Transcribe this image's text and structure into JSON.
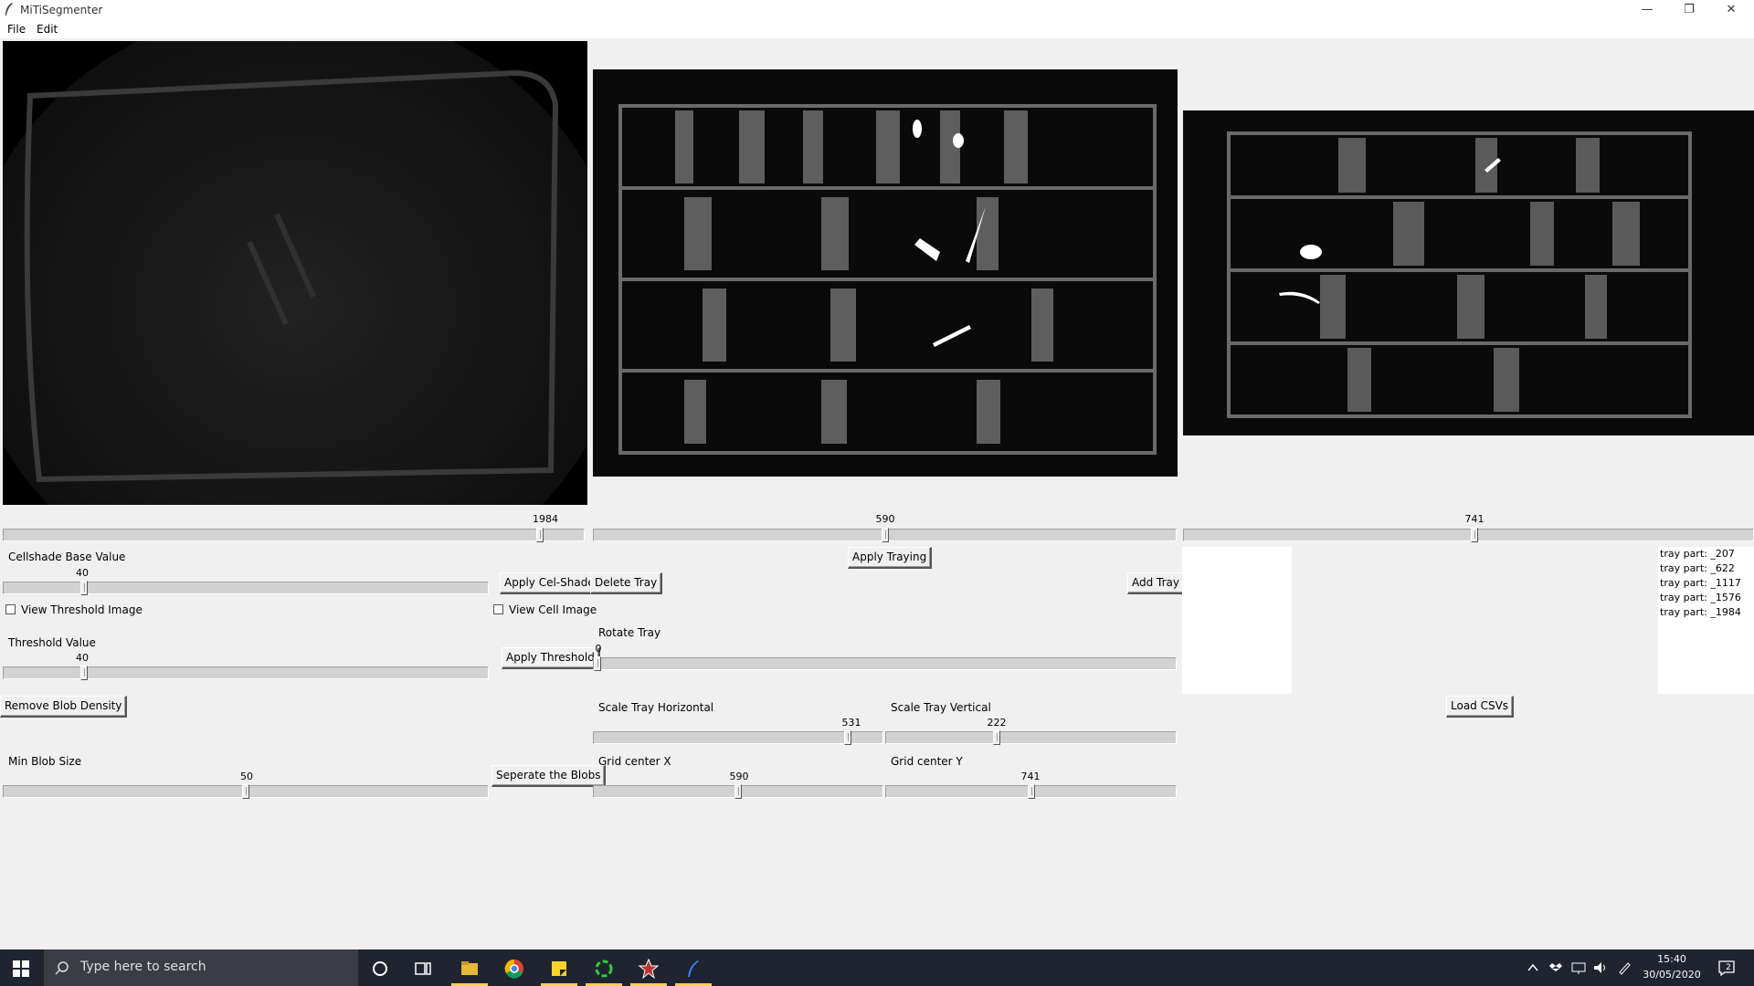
{
  "window": {
    "title": "MiTiSegmenter",
    "minimize": "—",
    "restore": "❐",
    "close": "✕"
  },
  "menu": {
    "file": "File",
    "edit": "Edit"
  },
  "sliders_top": {
    "left_value": "1984",
    "mid_value": "590",
    "right_value": "741"
  },
  "slider_levels": {
    "top_left": 0.93,
    "top_mid": 0.5,
    "top_right": 0.51,
    "cellshade": 0.16,
    "threshold": 0.16,
    "rotate": 0.0,
    "scale_h": 0.89,
    "scale_v": 0.38,
    "min_blob": 0.5,
    "grid_x": 0.5,
    "grid_y": 0.5
  },
  "controls": {
    "cellshade_label": "Cellshade Base Value",
    "cellshade_value": "40",
    "view_threshold_label": "View Threshold Image",
    "threshold_label": "Threshold Value",
    "threshold_value": "40",
    "remove_blob_density": "Remove Blob Density",
    "min_blob_label": "Min Blob Size",
    "min_blob_value": "50",
    "apply_celshade": "Apply Cel-Shade",
    "delete_tray": "Delete Tray",
    "view_cell_label": "View Cell Image",
    "apply_threshold": "Apply Threshold",
    "separate_blobs": "Seperate the Blobs",
    "apply_traying": "Apply Traying",
    "add_tray": "Add Tray",
    "rotate_label": "Rotate Tray",
    "rotate_value": "0",
    "scale_h_label": "Scale Tray Horizontal",
    "scale_h_value": "531",
    "scale_v_label": "Scale Tray Vertical",
    "scale_v_value": "222",
    "grid_x_label": "Grid center X",
    "grid_x_value": "590",
    "grid_y_label": "Grid center Y",
    "grid_y_value": "741",
    "load_csvs": "Load CSVs"
  },
  "tray_parts": [
    "tray part: _207",
    "tray part: _622",
    "tray part: _1117",
    "tray part: _1576",
    "tray part: _1984"
  ],
  "taskbar": {
    "search_placeholder": "Type here to search",
    "time": "15:40",
    "date": "30/05/2020",
    "notification_count": "2",
    "icons": [
      "windows-start-icon",
      "search-icon",
      "cortana-icon",
      "task-view-icon",
      "file-explorer-icon",
      "chrome-icon",
      "sticky-notes-icon",
      "app-green-icon",
      "app-red-icon",
      "python-feather-icon"
    ]
  },
  "colors": {
    "taskbar": "#1f2430",
    "window_bg": "#f0f0f0",
    "image_bg": "#000000"
  }
}
